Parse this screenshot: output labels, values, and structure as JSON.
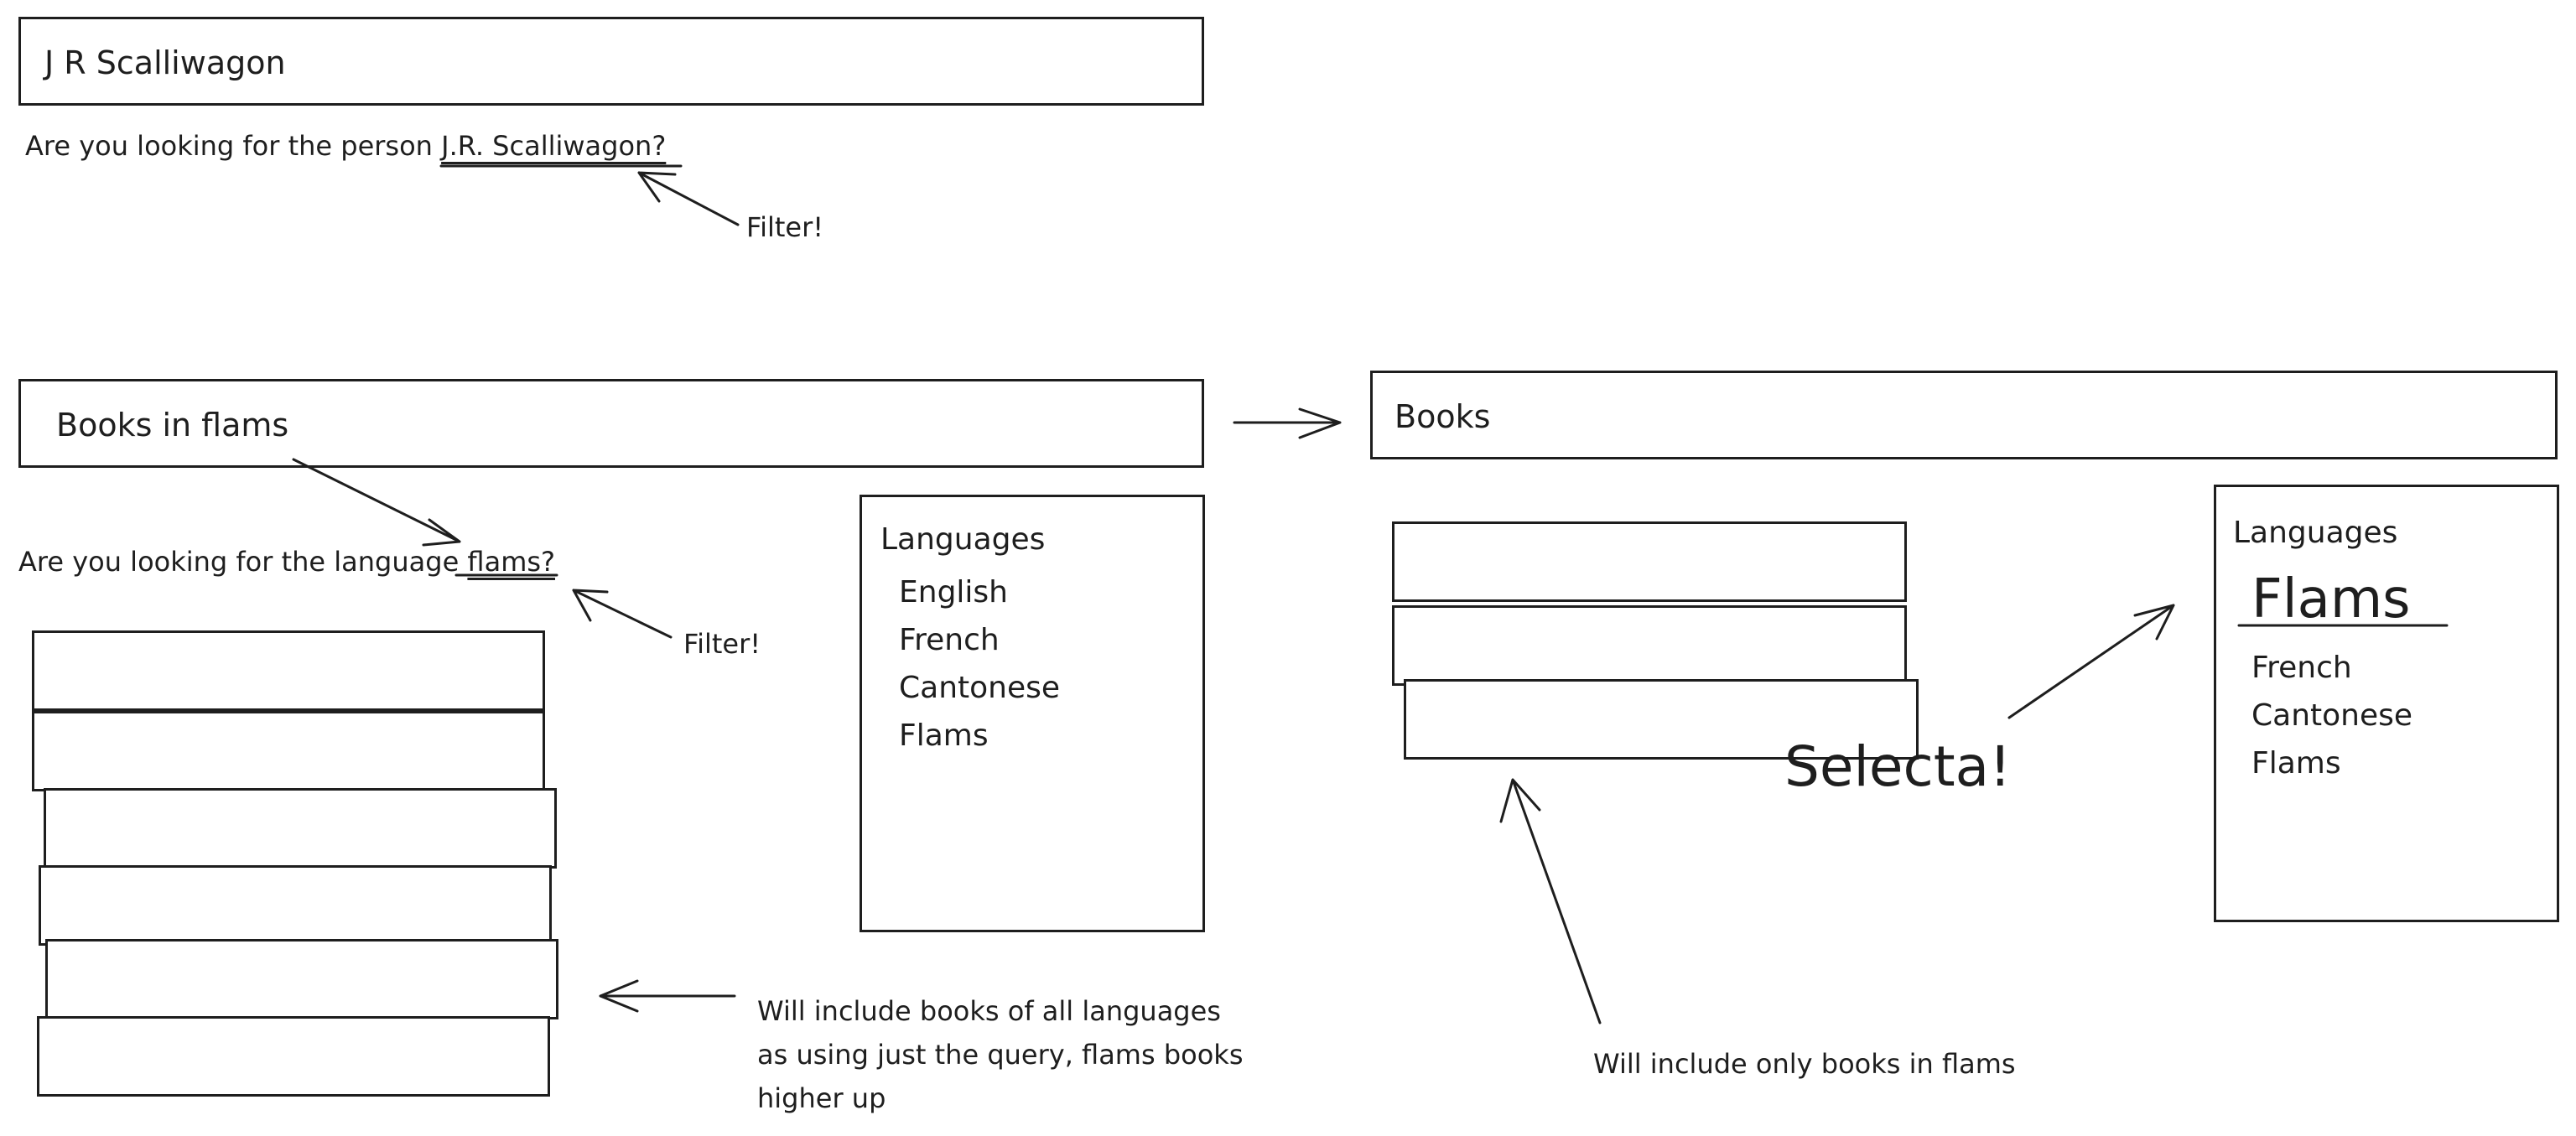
{
  "person_section": {
    "search_value": "J R Scalliwagon",
    "suggestion_prefix": "Are you looking for the person",
    "suggestion_link": "J.R. Scalliwagon?",
    "note": "Filter!"
  },
  "left_mockup": {
    "search_value": "Books in flams",
    "suggestion_prefix": "Are you looking for the language",
    "suggestion_link": "flams?",
    "filter_note": "Filter!",
    "languages_panel": {
      "title": "Languages",
      "items": [
        "English",
        "French",
        "Cantonese",
        "Flams"
      ]
    },
    "result_count": 6,
    "annotation_lines": [
      "Will include books of all languages",
      "as using just the query, flams books",
      "higher up"
    ]
  },
  "right_mockup": {
    "search_value": "Books",
    "languages_panel": {
      "title": "Languages",
      "selected": "Flams",
      "items": [
        "French",
        "Cantonese",
        "Flams"
      ]
    },
    "result_count": 3,
    "select_note": "Selecta!",
    "annotation": "Will include only books in flams"
  }
}
